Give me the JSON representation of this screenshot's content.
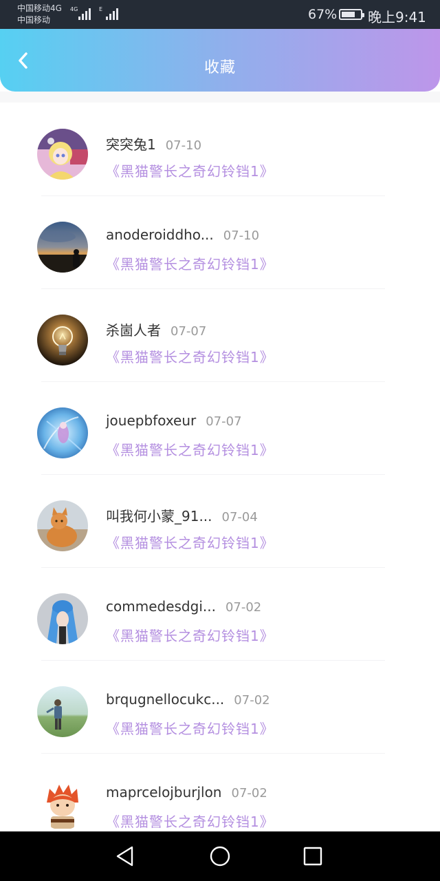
{
  "status_bar": {
    "carrier_1": "中国移动4G",
    "carrier_2": "中国移动",
    "sig1_tag": "4G",
    "sig2_tag": "E",
    "battery": "67%",
    "time": "晚上9:41"
  },
  "header": {
    "title": "收藏"
  },
  "favorites": [
    {
      "name": "突突兔1",
      "date": "07-10",
      "movie": "《黑猫警长之奇幻铃铛1》",
      "avatar": "anime-girl-avatar"
    },
    {
      "name": "anoderoiddho...",
      "date": "07-10",
      "movie": "《黑猫警长之奇幻铃铛1》",
      "avatar": "dusk-silhouette-avatar"
    },
    {
      "name": "杀崮人者",
      "date": "07-07",
      "movie": "《黑猫警长之奇幻铃铛1》",
      "avatar": "lightbulb-avatar"
    },
    {
      "name": "jouepbfoxeur",
      "date": "07-07",
      "movie": "《黑猫警长之奇幻铃铛1》",
      "avatar": "blue-fantasy-avatar"
    },
    {
      "name": "叫我何小蒙_91...",
      "date": "07-04",
      "movie": "《黑猫警长之奇幻铃铛1》",
      "avatar": "orange-cat-avatar"
    },
    {
      "name": "commedesdgi...",
      "date": "07-02",
      "movie": "《黑猫警长之奇幻铃铛1》",
      "avatar": "blue-hair-avatar"
    },
    {
      "name": "brqugnellocukc...",
      "date": "07-02",
      "movie": "《黑猫警长之奇幻铃铛1》",
      "avatar": "field-person-avatar"
    },
    {
      "name": "maprcelojburjlon",
      "date": "07-02",
      "movie": "《黑猫警长之奇幻铃铛1》",
      "avatar": "cartoon-redhead-avatar"
    }
  ],
  "colors": {
    "header_gradient_start": "#56d0f2",
    "header_gradient_end": "#bd96ea",
    "movie_title": "#b48fe0",
    "date": "#9a9a9a"
  },
  "nav_bar": {
    "back_icon": "triangle-back-icon",
    "home_icon": "circle-home-icon",
    "recents_icon": "square-recents-icon"
  }
}
